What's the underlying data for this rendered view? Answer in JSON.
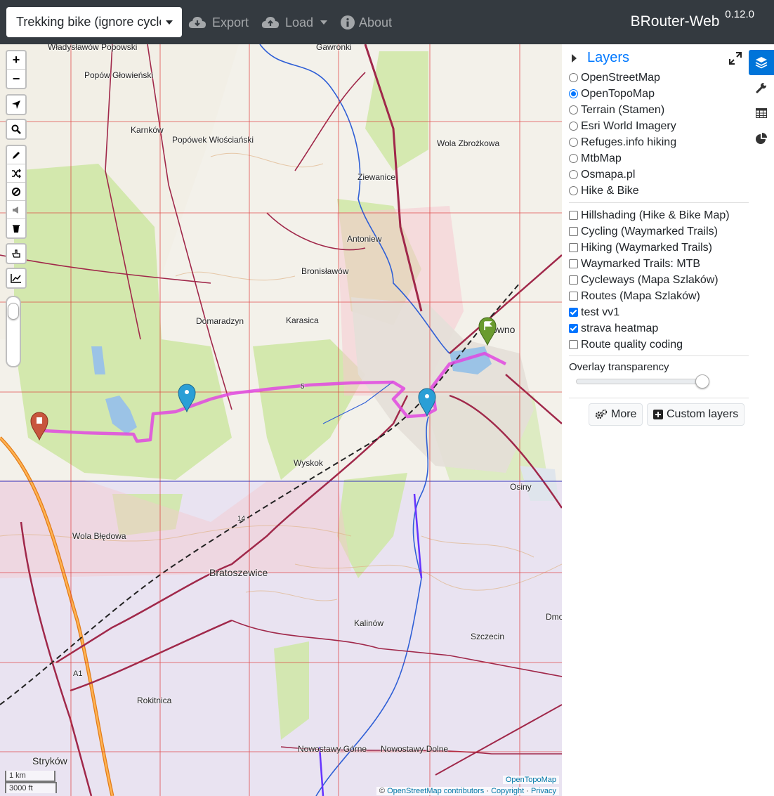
{
  "navbar": {
    "profile": "Trekking bike (ignore cycleroutes)",
    "export_label": "Export",
    "load_label": "Load",
    "about_label": "About",
    "brand": "BRouter-Web",
    "version": "0.12.0"
  },
  "map": {
    "place_labels": [
      "Władysławów Popowski",
      "Gawronki",
      "Popów Głowieński",
      "Karnków",
      "Popówek Włościański",
      "Wola Zbrożkowa",
      "Ziewanice",
      "Antoniew",
      "Bronisławów",
      "Domaradzyn",
      "Karasica",
      "Głowno",
      "Wyskok",
      "Osiny",
      "Wola Błędowa",
      "Bratoszewice",
      "Kalinów",
      "Szczecin",
      "Dmo",
      "Rokitnica",
      "Stryków",
      "Nowostawy Górne",
      "Nowostawy Dolne"
    ],
    "road_numbers": [
      "5",
      "14",
      "A1"
    ],
    "scale": {
      "metric": "1 km",
      "imperial": "3000 ft"
    },
    "attribution": {
      "layer": "OpenTopoMap",
      "prefix": "©",
      "osm": "OpenStreetMap contributors",
      "sep1": "·",
      "copyright": "Copyright",
      "sep2": "·",
      "privacy": "Privacy"
    },
    "colors": {
      "route": "#e048e0",
      "grid_red": "#dd3333",
      "grid_blue": "#3333bb",
      "marker_start": "#6a9b2f",
      "marker_via": "#2a9fd6",
      "marker_end": "#c8553d"
    }
  },
  "controls": {
    "zoom_in": "+",
    "zoom_out": "−"
  },
  "sidebar": {
    "title": "Layers",
    "base_layers": [
      {
        "label": "OpenStreetMap",
        "selected": false
      },
      {
        "label": "OpenTopoMap",
        "selected": true
      },
      {
        "label": "Terrain (Stamen)",
        "selected": false
      },
      {
        "label": "Esri World Imagery",
        "selected": false
      },
      {
        "label": "Refuges.info hiking",
        "selected": false
      },
      {
        "label": "MtbMap",
        "selected": false
      },
      {
        "label": "Osmapa.pl",
        "selected": false
      },
      {
        "label": "Hike & Bike",
        "selected": false
      }
    ],
    "overlays": [
      {
        "label": "Hillshading (Hike & Bike Map)",
        "checked": false
      },
      {
        "label": "Cycling (Waymarked Trails)",
        "checked": false
      },
      {
        "label": "Hiking (Waymarked Trails)",
        "checked": false
      },
      {
        "label": "Waymarked Trails: MTB",
        "checked": false
      },
      {
        "label": "Cycleways (Mapa Szlaków)",
        "checked": false
      },
      {
        "label": "Routes (Mapa Szlaków)",
        "checked": false
      },
      {
        "label": "test vv1",
        "checked": true
      },
      {
        "label": "strava heatmap",
        "checked": true
      },
      {
        "label": "Route quality coding",
        "checked": false
      }
    ],
    "transparency_label": "Overlay transparency",
    "transparency_value": 1.0,
    "more_label": "More",
    "custom_layers_label": "Custom layers"
  }
}
